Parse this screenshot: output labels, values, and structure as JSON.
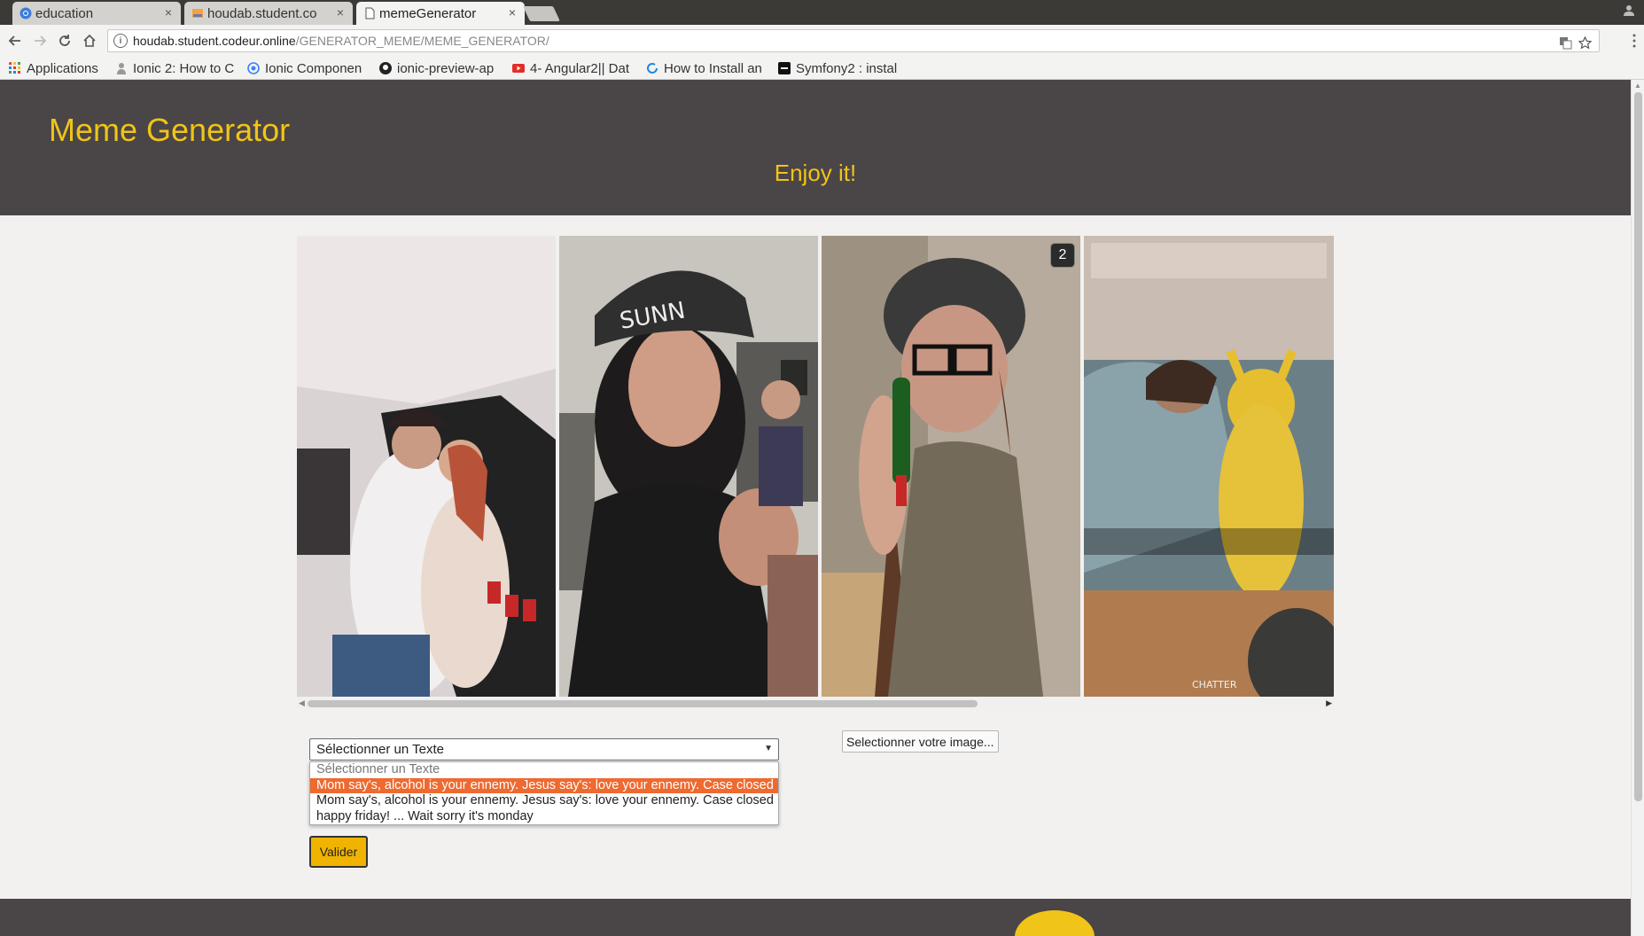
{
  "browser": {
    "tabs": [
      {
        "title": "education",
        "active": false
      },
      {
        "title": "houdab.student.co",
        "active": false
      },
      {
        "title": "memeGenerator",
        "active": true
      }
    ],
    "tab_close_glyph": "×",
    "url_host": "houdab.student.codeur.online",
    "url_path": "/GENERATOR_MEME/MEME_GENERATOR/",
    "bookmarks": [
      {
        "label": "Applications",
        "icon": "apps-grid-icon"
      },
      {
        "label": "Ionic 2: How to C",
        "icon": "person-icon"
      },
      {
        "label": "Ionic Componen",
        "icon": "ionic-icon"
      },
      {
        "label": "ionic-preview-ap",
        "icon": "github-icon"
      },
      {
        "label": "4- Angular2|| Dat",
        "icon": "youtube-icon"
      },
      {
        "label": "How to Install an",
        "icon": "refresh-logo-icon"
      },
      {
        "label": "Symfony2 : instal",
        "icon": "symfony-icon"
      }
    ]
  },
  "header": {
    "title": "Meme Generator",
    "tagline": "Enjoy it!"
  },
  "gallery": {
    "badge": "2",
    "watermark": "CHATTER"
  },
  "form": {
    "select_value": "Sélectionner un Texte",
    "options": [
      "Sélectionner un Texte",
      "Mom say's, alcohol is your ennemy. Jesus say's: love your ennemy. Case closed",
      "Mom say's, alcohol is your ennemy. Jesus say's: love your ennemy. Case closed",
      "happy friday! ... Wait sorry it's monday"
    ],
    "file_button": "Selectionner votre image...",
    "submit": "Valider"
  },
  "colors": {
    "header_bg": "#4a4546",
    "accent_yellow": "#f0c419",
    "option_highlight": "#ee6a30",
    "submit_bg": "#f0b400"
  }
}
